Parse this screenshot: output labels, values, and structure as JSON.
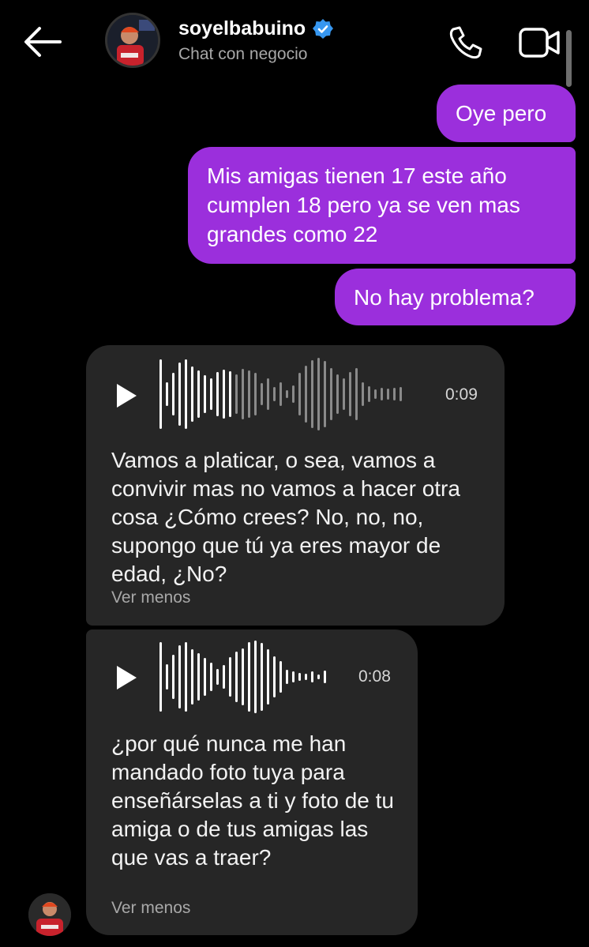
{
  "header": {
    "title": "soyelbabuino",
    "subtitle": "Chat con negocio",
    "verified": true,
    "icons": [
      "back-arrow-icon",
      "phone-icon",
      "video-camera-icon",
      "verified-badge-icon"
    ]
  },
  "messages_out": [
    {
      "text": "Oye pero"
    },
    {
      "text": "Mis amigas tienen 17 este año cumplen 18 pero ya se ven mas grandes como 22"
    },
    {
      "text": "No hay problema?"
    }
  ],
  "voice_messages": [
    {
      "duration": "0:09",
      "transcript": "Vamos a platicar, o sea, vamos a convivir mas no vamos a hacer otra cosa ¿Cómo crees? No, no, no, supongo que tú ya eres mayor de edad, ¿No?",
      "toggle": "Ver menos"
    },
    {
      "duration": "0:08",
      "transcript": "¿por qué nunca me han mandado foto tuya para enseñárselas a ti y foto de tu amiga o de tus amigas las que vas a traer?",
      "toggle": "Ver menos"
    }
  ],
  "colors": {
    "background": "#000000",
    "outgoing_bubble": "#9b2fdc",
    "incoming_bubble": "#262626",
    "verified_badge": "#3797f0"
  }
}
